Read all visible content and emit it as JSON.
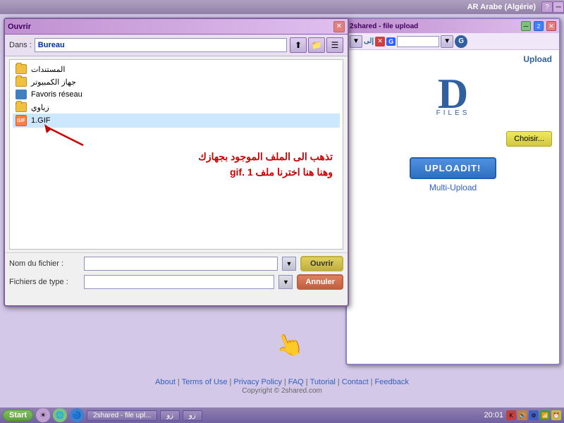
{
  "topbar": {
    "title": "AR Arabe (Algérie)"
  },
  "file_dialog": {
    "title": "Ouvrir",
    "location_label": "Dans :",
    "location_value": "Bureau",
    "items": [
      {
        "name": "المستندات",
        "type": "folder"
      },
      {
        "name": "جهاز الكمبيوتر",
        "type": "folder"
      },
      {
        "name": "Favoris réseau",
        "type": "network"
      },
      {
        "name": "زياوي",
        "type": "folder"
      },
      {
        "name": "1.GIF",
        "type": "gif"
      }
    ],
    "annotation_line1": "تذهب الى الملف الموجود بجهازك",
    "annotation_line2": "وهنا هنا اخترنا ملف 1  .gif",
    "filename_label": "Nom du fichier :",
    "filetype_label": "Fichiers de type :",
    "open_btn": "Ouvrir",
    "cancel_btn": "Annuler"
  },
  "browser": {
    "title": "2shared - file upload",
    "logo_letter": "D",
    "logo_subtitle": "FILES",
    "choisir_btn": "Choisir...",
    "upload_btn": "UPLOADIT!",
    "upload_link": "Multi-Upload",
    "upload_label": "Upload"
  },
  "footer": {
    "about": "About",
    "terms": "Terms of Use",
    "privacy": "Privacy Policy",
    "faq": "FAQ",
    "tutorial": "Tutorial",
    "contact": "Contact",
    "feedback": "Feedback",
    "copyright": "Copyright © 2shared.com"
  },
  "taskbar": {
    "start_label": "Start",
    "items": [
      "2shared - file upl...",
      "زو",
      "زو"
    ],
    "time": "20:01"
  }
}
